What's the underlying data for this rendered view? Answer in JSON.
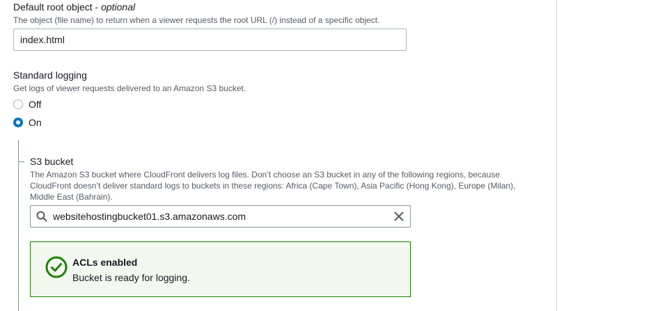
{
  "default_root": {
    "title": "Default root object - ",
    "title_optional": "optional",
    "description": "The object (file name) to return when a viewer requests the root URL (/) instead of a specific object.",
    "value": "index.html"
  },
  "standard_logging": {
    "title": "Standard logging",
    "description": "Get logs of viewer requests delivered to an Amazon S3 bucket.",
    "options": [
      {
        "label": "Off",
        "selected": false
      },
      {
        "label": "On",
        "selected": true
      }
    ]
  },
  "s3_bucket": {
    "title": "S3 bucket",
    "description_line1": "The Amazon S3 bucket where CloudFront delivers log files. Don’t choose an S3 bucket in any of the following regions, because",
    "description_line2": "CloudFront doesn’t deliver standard logs to buckets in these regions: Africa (Cape Town), Asia Pacific (Hong Kong), Europe (Milan),",
    "description_line3": "Middle East (Bahrain).",
    "value": "websitehostingbucket01.s3.amazonaws.com",
    "search_icon": "search-icon",
    "clear_icon": "close-icon"
  },
  "alert": {
    "type": "success",
    "icon": "check-circle-icon",
    "title": "ACLs enabled",
    "body": "Bucket is ready for logging."
  },
  "colors": {
    "accent": "#0073bb",
    "success": "#1d8102",
    "success_bg": "#f2f8f0",
    "text": "#16191f",
    "muted_text": "#545b64"
  }
}
